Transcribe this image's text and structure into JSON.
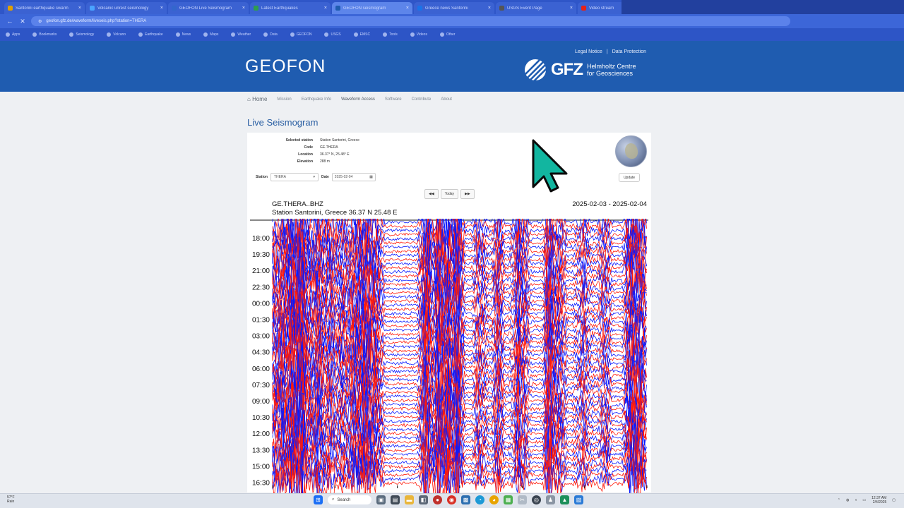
{
  "browser": {
    "tabs": [
      {
        "title": "Santorini earthquake swarm",
        "color": "#e0a000",
        "active": false
      },
      {
        "title": "Volcanic unrest seismology",
        "color": "#4aa3ff",
        "active": false
      },
      {
        "title": "GEOFON Live Seismogram",
        "color": "#3366cc",
        "active": false
      },
      {
        "title": "Latest Earthquakes",
        "color": "#2e9d4f",
        "active": false
      },
      {
        "title": "GEOFON seismogram",
        "color": "#1f5cb0",
        "active": true
      },
      {
        "title": "Greece news Santorini",
        "color": "#1a73e8",
        "active": false
      },
      {
        "title": "USGS Event Page",
        "color": "#555555",
        "active": false
      },
      {
        "title": "Video stream",
        "color": "#e62117",
        "active": false
      }
    ],
    "url": "geofon.gfz.de/waveform/liveseis.php?station=THERA",
    "bookmarks": [
      "Apps",
      "Bookmarks",
      "Seismology",
      "Volcano",
      "Earthquake",
      "News",
      "Maps",
      "Weather",
      "Data",
      "GEOFON",
      "USGS",
      "EMSC",
      "Tools",
      "Videos",
      "Other"
    ]
  },
  "site": {
    "brand": "GEOFON",
    "top_links": [
      "Legal Notice",
      "|",
      "Data Protection"
    ],
    "partner_logo": "GFZ",
    "partner_line1": "Helmholtz Centre",
    "partner_line2": "for Geosciences",
    "menu": [
      "Home",
      "Mission",
      "Earthquake Info",
      "Waveform Access",
      "Software",
      "Contribute",
      "About"
    ],
    "page_title": "Live Seismogram"
  },
  "station_info": [
    {
      "key": "Selected station",
      "value": "Station Santorini, Greece"
    },
    {
      "key": "Code",
      "value": "GE.THERA"
    },
    {
      "key": "Location",
      "value": "36.37° N, 25.48° E"
    },
    {
      "key": "Elevation",
      "value": "288 m"
    }
  ],
  "controls": {
    "station_label": "Station",
    "station_value": "THERA",
    "date_label": "Date",
    "date_value": "2025-02-04",
    "update": "Update",
    "prev": "◀◀",
    "today": "Today",
    "next": "▶▶"
  },
  "plot": {
    "channel": "GE.THERA..BHZ",
    "station_line": "Station Santorini, Greece  36.37 N 25.48 E",
    "date_range": "2025-02-03 - 2025-02-04",
    "time_labels": [
      "18:00",
      "19:30",
      "21:00",
      "22:30",
      "00:00",
      "01:30",
      "03:00",
      "04:30",
      "06:00",
      "07:30",
      "09:00",
      "10:30",
      "12:00",
      "13:30",
      "15:00",
      "16:30"
    ],
    "trace_colors": [
      "#0a1aff",
      "#ff1a0a"
    ]
  },
  "taskbar": {
    "weather_temp": "57°F",
    "weather_desc": "Rain",
    "search": "Search",
    "time": "12:37 AM",
    "date": "2/4/2025"
  }
}
